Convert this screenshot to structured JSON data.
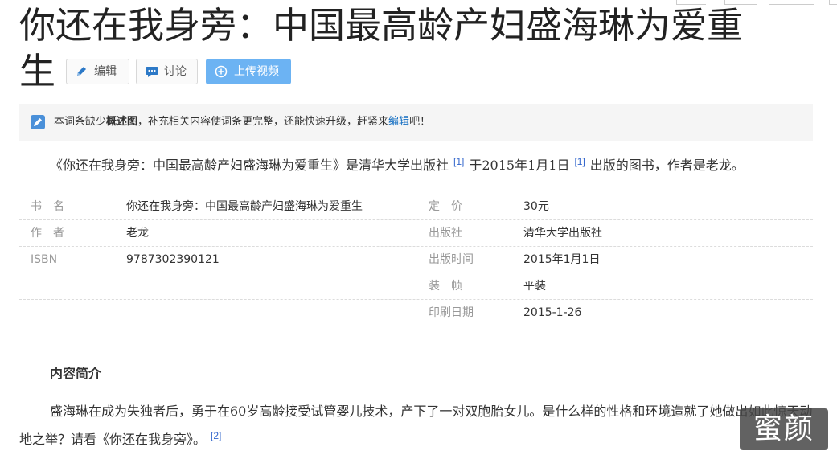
{
  "title": {
    "line1": "你还在我身旁：中国最高龄产妇盛海琳为爱重",
    "line2": "生"
  },
  "buttons": {
    "edit": "编辑",
    "discuss": "讨论",
    "upload": "上传视频"
  },
  "notice": {
    "prefix": "本词条缺少",
    "bold": "概述图",
    "middle": "，补充相关内容使词条更完整，还能快速升级，赶紧来",
    "link": "编辑",
    "suffix": "吧！"
  },
  "intro": {
    "part1": "《你还在我身旁：中国最高龄产妇盛海琳为爱重生》是清华大学出版社",
    "ref1": "[1]",
    "part2": "于2015年1月1日",
    "ref2": "[1]",
    "part3": "出版的图书，作者是老龙。"
  },
  "info_rows": [
    {
      "k1": "书　名",
      "v1": "你还在我身旁：中国最高龄产妇盛海琳为爱重生",
      "k2": "定　价",
      "v2": "30元"
    },
    {
      "k1": "作　者",
      "v1": "老龙",
      "k2": "出版社",
      "v2": "清华大学出版社"
    },
    {
      "k1": "ISBN",
      "v1": "9787302390121",
      "k2": "出版时间",
      "v2": "2015年1月1日"
    },
    {
      "k1": "",
      "v1": "",
      "k2": "装　帧",
      "v2": "平装"
    },
    {
      "k1": "",
      "v1": "",
      "k2": "印刷日期",
      "v2": "2015-1-26"
    }
  ],
  "section": {
    "title": "内容简介",
    "text": "盛海琳在成为失独者后，勇于在60岁高龄接受试管婴儿技术，产下了一对双胞胎女儿。是什么样的性格和环境造就了她做出如此惊天动地之举？请看《你还在我身旁》。",
    "ref": "[2]"
  },
  "watermark": "蜜颜",
  "colors": {
    "link": "#136ec2",
    "upload_button": "#6cb3f3",
    "notice_bg": "#f5f5f5",
    "label": "#999999"
  }
}
